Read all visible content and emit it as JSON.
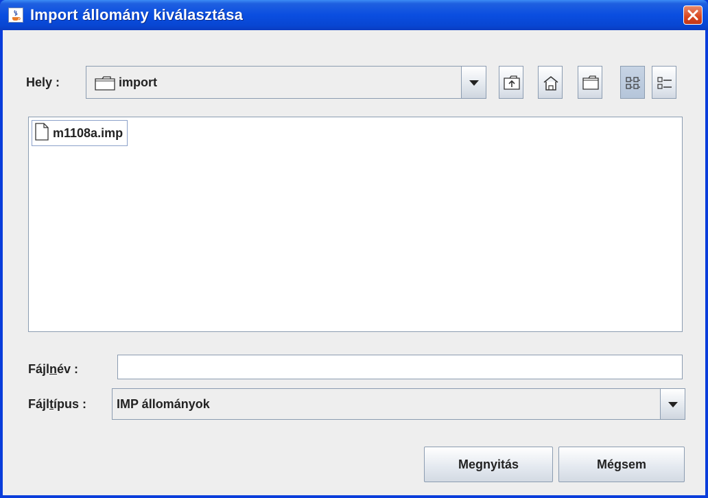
{
  "window": {
    "title": "Import állomány kiválasztása",
    "app_icon": "java-cup-icon",
    "close_icon": "close-icon"
  },
  "location": {
    "label": "Hely :",
    "value": "import",
    "icon": "folder-icon"
  },
  "toolbar": [
    {
      "name": "up-one-level-button",
      "icon": "up-folder-icon",
      "pressed": false
    },
    {
      "name": "home-button",
      "icon": "home-icon",
      "pressed": false
    },
    {
      "name": "new-folder-button",
      "icon": "new-folder-icon",
      "pressed": false
    },
    {
      "name": "list-view-button",
      "icon": "list-view-icon",
      "pressed": true
    },
    {
      "name": "details-view-button",
      "icon": "details-view-icon",
      "pressed": false
    }
  ],
  "files": [
    {
      "name": "m1108a.imp",
      "icon": "file-icon"
    }
  ],
  "filename": {
    "label_pre": "Fájl",
    "label_mnemonic": "n",
    "label_post": "év :",
    "value": ""
  },
  "filetype": {
    "label_pre": "Fájl",
    "label_mnemonic": "t",
    "label_post": "ípus :",
    "value": "IMP állományok"
  },
  "buttons": {
    "open": "Megnyitás",
    "cancel": "Mégsem"
  },
  "colors": {
    "titlebar": "#0a4ee0",
    "client": "#eeeeee",
    "close": "#d9461f"
  }
}
